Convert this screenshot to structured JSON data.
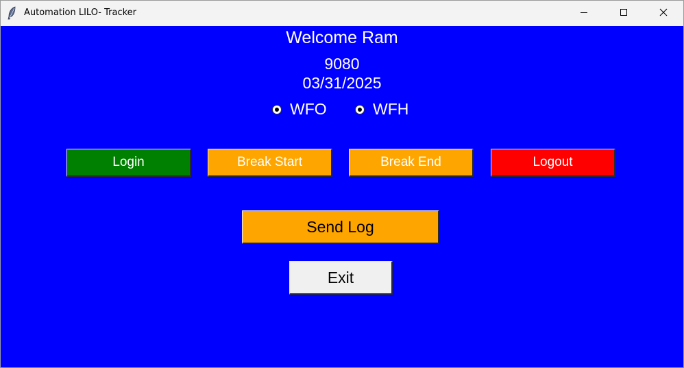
{
  "window": {
    "title": "Automation LILO- Tracker",
    "icons": {
      "app": "feather-icon",
      "minimize": "minimize-icon",
      "maximize": "maximize-icon",
      "close": "close-icon"
    }
  },
  "header": {
    "welcome": "Welcome Ram",
    "employee_id": "9080",
    "date": "03/31/2025"
  },
  "work_mode": {
    "options": [
      {
        "label": "WFO"
      },
      {
        "label": "WFH"
      }
    ]
  },
  "actions": {
    "login": "Login",
    "break_start": "Break Start",
    "break_end": "Break End",
    "logout": "Logout",
    "send_log": "Send Log",
    "exit": "Exit"
  },
  "colors": {
    "background": "#0000ff",
    "login": "#008000",
    "break": "#ffa500",
    "logout": "#ff0000",
    "exit": "#f0f0f0"
  }
}
